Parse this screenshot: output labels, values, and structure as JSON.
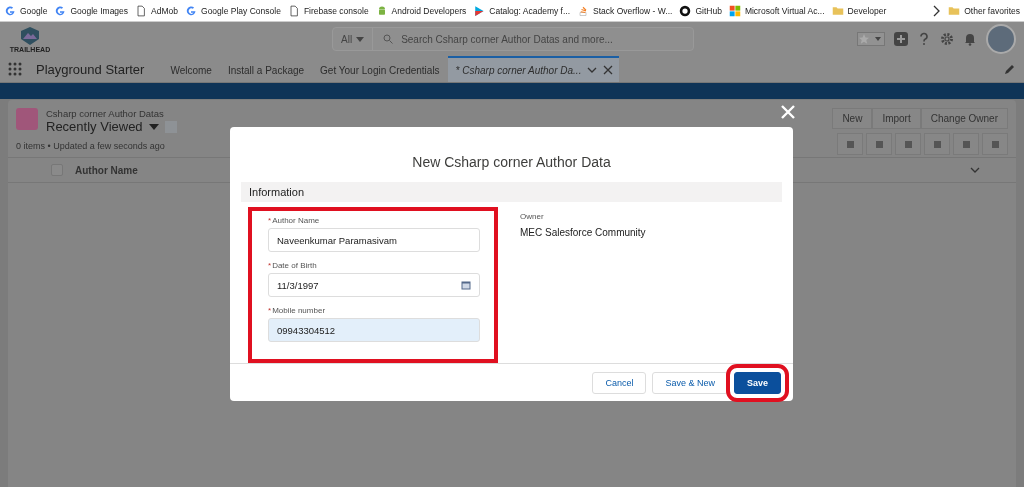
{
  "bookmarks": [
    {
      "label": "Google",
      "kind": "g"
    },
    {
      "label": "Google Images",
      "kind": "g"
    },
    {
      "label": "AdMob",
      "kind": "page"
    },
    {
      "label": "Google Play Console",
      "kind": "g"
    },
    {
      "label": "Firebase console",
      "kind": "page"
    },
    {
      "label": "Android Developers",
      "kind": "android"
    },
    {
      "label": "Catalog: Academy f...",
      "kind": "play"
    },
    {
      "label": "Stack Overflow - W...",
      "kind": "stack"
    },
    {
      "label": "GitHub",
      "kind": "github"
    },
    {
      "label": "Microsoft Virtual Ac...",
      "kind": "ms"
    },
    {
      "label": "Developer",
      "kind": "folder"
    }
  ],
  "other_favorites": {
    "label": "Other favorites"
  },
  "header": {
    "logo_text": "TRAILHEAD",
    "search_scope": "All",
    "search_placeholder": "Search Csharp corner Author Datas and more..."
  },
  "nav": {
    "app_name": "Playground Starter",
    "tabs": [
      {
        "label": "Welcome",
        "selected": false
      },
      {
        "label": "Install a Package",
        "selected": false
      },
      {
        "label": "Get Your Login Credentials",
        "selected": false
      },
      {
        "label": "* Csharp corner Author Da...",
        "selected": true
      }
    ]
  },
  "list_view": {
    "object_name": "Csharp corner Author Datas",
    "view_name": "Recently Viewed",
    "status": "0 items • Updated a few seconds ago",
    "buttons": [
      "New",
      "Import",
      "Change Owner"
    ],
    "columns": [
      "Author Name"
    ],
    "select_all_checked": false
  },
  "modal": {
    "title": "New Csharp corner Author Data",
    "section": "Information",
    "fields_highlighted": true,
    "fields": [
      {
        "label": "Author Name",
        "required_mark": "*",
        "value": "Naveenkumar Paramasivam",
        "kind": "text",
        "focused": false
      },
      {
        "label": "Date of Birth",
        "required_mark": "*",
        "value": "11/3/1997",
        "kind": "date",
        "focused": false
      },
      {
        "label": "Mobile number",
        "required_mark": "*",
        "value": "09943304512",
        "kind": "text",
        "focused": true
      }
    ],
    "owner": {
      "label": "Owner",
      "value": "MEC Salesforce Community"
    },
    "buttons": [
      {
        "label": "Cancel",
        "kind": "neutral",
        "highlighted": false
      },
      {
        "label": "Save & New",
        "kind": "neutral",
        "highlighted": false
      },
      {
        "label": "Save",
        "kind": "brand",
        "highlighted": true
      }
    ]
  }
}
